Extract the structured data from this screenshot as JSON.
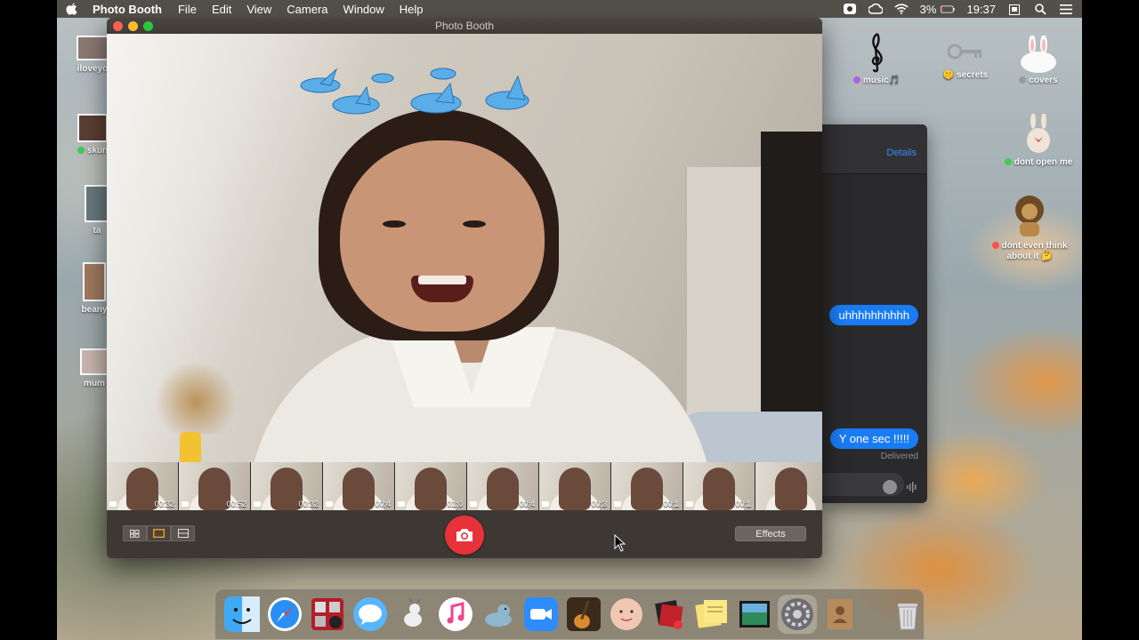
{
  "menubar": {
    "app_name": "Photo Booth",
    "menus": [
      "File",
      "Edit",
      "View",
      "Camera",
      "Window",
      "Help"
    ],
    "battery": "3%",
    "time": "19:37",
    "status_icons": [
      "screen-recording-icon",
      "creative-cloud-icon",
      "wifi-icon",
      "battery-icon",
      "clipboard-icon",
      "search-icon",
      "control-list-icon"
    ]
  },
  "desktop_left_icons": [
    {
      "label": "iloveyo"
    },
    {
      "label": "skun"
    },
    {
      "label": "ta"
    },
    {
      "label": "beany"
    },
    {
      "label": "mum"
    }
  ],
  "desktop_right_icons": [
    {
      "label": "music",
      "emoji": "🎵",
      "tag_color": "#b360e0"
    },
    {
      "label": "secrets",
      "emoji": "🤫",
      "tag_color": ""
    },
    {
      "label": "covers",
      "tag_color": "#9a9a9a"
    },
    {
      "label": "dont open me",
      "tag_color": "#3ecf4f"
    },
    {
      "label": "dont even think about it",
      "emoji": "🤔",
      "tag_color": "#ff4d4d"
    }
  ],
  "messages": {
    "details_label": "Details",
    "bubble_1": "uhhhhhhhhhh",
    "bubble_2": "Y one sec !!!!!",
    "delivered": "Delivered"
  },
  "photobooth": {
    "title": "Photo Booth",
    "effects_label": "Effects",
    "thumbnails": [
      {
        "duration": "00:32"
      },
      {
        "duration": "00:52"
      },
      {
        "duration": "00:32"
      },
      {
        "duration": "00:4"
      },
      {
        "duration": "01:0"
      },
      {
        "duration": "00:4"
      },
      {
        "duration": "00:3"
      },
      {
        "duration": "00:1"
      },
      {
        "duration": "00:1"
      },
      {
        "duration": ""
      }
    ],
    "active_layout": "single"
  },
  "dock": {
    "apps": [
      "finder-icon",
      "safari-icon",
      "photo-booth-icon",
      "messages-icon",
      "goat-icon",
      "itunes-icon",
      "seal-icon",
      "zoom-icon",
      "garageband-icon",
      "face-icon",
      "photo-stack-icon",
      "stickies-icon",
      "preview-icon",
      "system-preferences-icon",
      "contacts-icon",
      "trash-icon"
    ]
  },
  "colors": {
    "shutter": "#e8323a",
    "messages_bubble": "#1a7cf5",
    "menubar": "#3c3730"
  }
}
